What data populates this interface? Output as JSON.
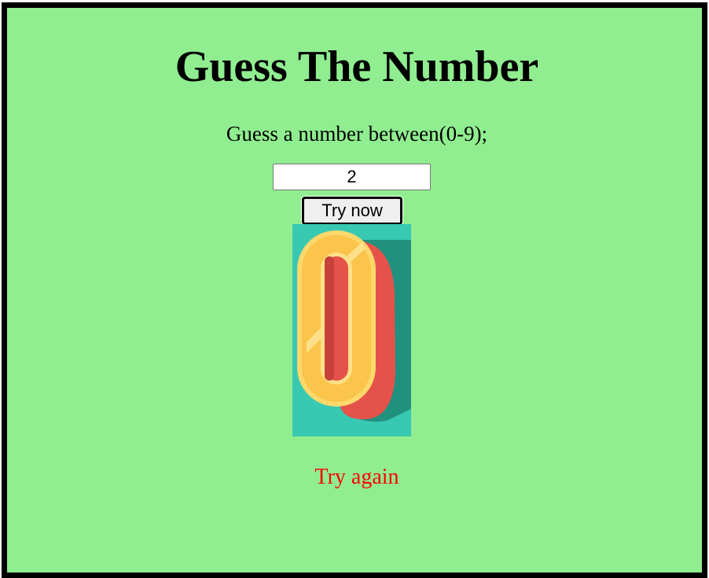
{
  "app": {
    "title": "Guess The Number",
    "prompt": "Guess a number between(0-9);"
  },
  "form": {
    "guess_value": "2",
    "submit_label": "Try now"
  },
  "result": {
    "image_icon": "digit-zero-illustration",
    "message": "Try again",
    "message_color": "#ff0000"
  },
  "colors": {
    "page_background": "#90ee90",
    "frame_border": "#000000"
  }
}
